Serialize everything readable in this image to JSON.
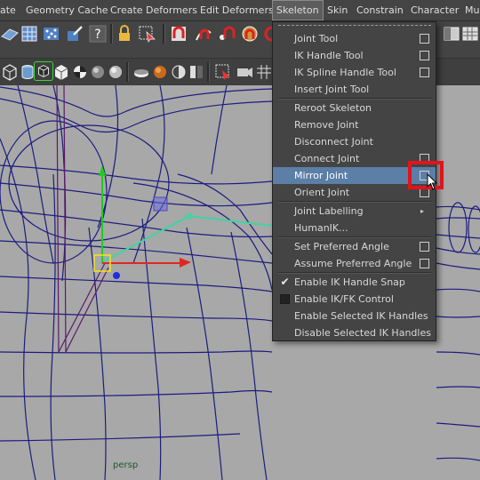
{
  "menubar": {
    "items": [
      "ate",
      "Geometry Cache",
      "Create Deformers",
      "Edit Deformers",
      "Skeleton",
      "Skin",
      "Constrain",
      "Character",
      "Mu"
    ],
    "active": "Skeleton"
  },
  "shelf1_icons": [
    "plane-shelf-icon",
    "grid-shelf-icon",
    "scatter-shelf-icon",
    "paint-shelf-icon",
    "help-shelf-icon",
    "lock-shelf-icon",
    "select-shelf-icon",
    "magnet-snap-icon",
    "curve-snap-icon",
    "point-snap-icon",
    "view-snap-icon"
  ],
  "shelf1_right_icons": [
    "panel-layout-icon",
    "table-icon"
  ],
  "shelf2_icons": [
    "cube-icon",
    "cylinder-icon",
    "wire-box-icon",
    "textured-cube-icon",
    "checker-icon",
    "light-sphere-icon",
    "sphere-icon",
    "bowl-icon",
    "shaded-sphere-icon",
    "half-sphere-icon",
    "split-icon",
    "selection-mask-icon",
    "camera-icon"
  ],
  "skeleton_menu": {
    "items": [
      {
        "label": "Joint Tool",
        "option_box": true
      },
      {
        "label": "IK Handle Tool",
        "option_box": true
      },
      {
        "label": "IK Spline Handle Tool",
        "option_box": true
      },
      {
        "label": "Insert Joint Tool",
        "option_box": false
      },
      {
        "separator": true
      },
      {
        "label": "Reroot Skeleton",
        "option_box": false
      },
      {
        "label": "Remove Joint",
        "option_box": false
      },
      {
        "label": "Disconnect Joint",
        "option_box": false
      },
      {
        "label": "Connect Joint",
        "option_box": true
      },
      {
        "label": "Mirror Joint",
        "option_box": true,
        "hover": true
      },
      {
        "label": "Orient Joint",
        "option_box": true
      },
      {
        "separator": true
      },
      {
        "label": "Joint Labelling",
        "submenu": true
      },
      {
        "label": "HumanIK...",
        "option_box": false
      },
      {
        "separator": true
      },
      {
        "label": "Set Preferred Angle",
        "option_box": true
      },
      {
        "label": "Assume Preferred Angle",
        "option_box": true
      },
      {
        "separator": true
      },
      {
        "label": "Enable IK Handle Snap",
        "check": "checked"
      },
      {
        "label": "Enable IK/FK Control",
        "check": "unchecked"
      },
      {
        "label": "Enable Selected IK Handles",
        "option_box": false
      },
      {
        "label": "Disable Selected IK Handles",
        "option_box": false
      }
    ]
  },
  "viewport": {
    "camera_label": "persp",
    "wire_color": "#1a1a7a",
    "joint_color": "#3dd6a0",
    "highlight_color": "#e1141c"
  }
}
